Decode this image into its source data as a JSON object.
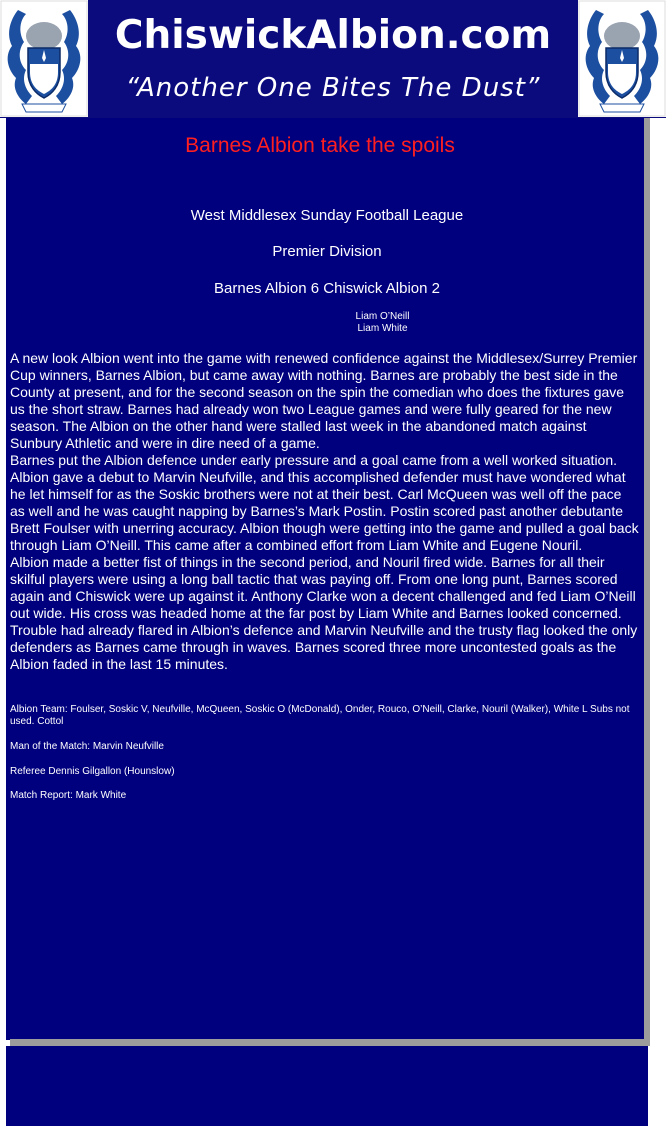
{
  "header": {
    "site_title": "ChiswickAlbion.com",
    "slogan": "“Another One Bites The Dust”"
  },
  "article": {
    "title": "Barnes Albion take the spoils",
    "league": "West Middlesex Sunday Football League",
    "division": "Premier Division",
    "scoreline": "Barnes Albion 6 Chiswick Albion 2",
    "scorers": [
      "Liam O’Neill",
      "Liam White"
    ],
    "paragraphs": [
      "A new look Albion went into the game with renewed confidence against the Middlesex/Surrey Premier Cup winners, Barnes Albion, but came away with nothing. Barnes are probably the best side in the County at present, and for the second season on the spin the comedian who does the fixtures gave us the short straw. Barnes had already won two League games and were fully geared for the new season. The Albion on the other hand were stalled last week in the abandoned match against Sunbury Athletic and were in dire need of a game.",
      "Barnes put the Albion defence under early pressure and a goal came from a well worked situation. Albion gave a debut to Marvin Neufville, and this accomplished defender must have wondered what he let himself for as the Soskic brothers were not at their best. Carl McQueen was well off the pace as well and he was caught napping by Barnes’s Mark Postin. Postin scored past another debutante Brett Foulser with unerring accuracy. Albion though were getting into the game and pulled a goal back through Liam O’Neill. This came after a combined effort from Liam White and Eugene Nouril.",
      "Albion made a better fist of things in the second period, and Nouril fired wide. Barnes for all their skilful players were using a long ball tactic that was paying off. From one long punt, Barnes scored again and Chiswick were up against it. Anthony Clarke won a decent challenged and fed Liam O’Neill out wide. His cross was headed home at the far post by Liam White and Barnes looked concerned. Trouble had already flared in Albion’s defence and Marvin Neufville and the trusty flag looked the only defenders as Barnes came through in waves. Barnes scored three more uncontested goals as the Albion faded in the last 15 minutes."
    ],
    "team": "Albion Team: Foulser, Soskic V, Neufville, McQueen, Soskic O (McDonald), Onder, Rouco, O’Neill, Clarke, Nouril (Walker), White L Subs not used. Cottol",
    "man_of_match": "Man of the Match: Marvin Neufville",
    "referee": "Referee Dennis Gilgallon (Hounslow)",
    "report_by": "Match Report: Mark White"
  },
  "colors": {
    "header_bg": "#0b0b7e",
    "panel_bg": "#00007f",
    "title_red": "#ff1f1f",
    "border_grey": "#9c9c9c",
    "crest_blue": "#1c4fa0"
  },
  "icons": [
    "club-crest-icon"
  ]
}
